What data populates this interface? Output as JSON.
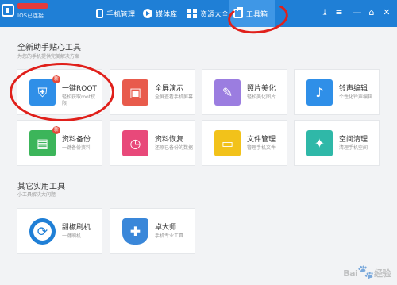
{
  "device": {
    "status": "IOS已连接"
  },
  "nav": {
    "tabs": [
      {
        "label": "手机管理",
        "icon": "phone-icon"
      },
      {
        "label": "媒体库",
        "icon": "media-play-icon"
      },
      {
        "label": "资源大全",
        "icon": "grid-icon"
      },
      {
        "label": "工具箱",
        "icon": "toolbox-icon",
        "active": true
      }
    ]
  },
  "window": {
    "download": "⤓",
    "menu": "≡",
    "minimize": "—",
    "skin": "⌂",
    "close": "✕"
  },
  "newbie": {
    "title": "全新助手贴心工具",
    "subtitle": "为您的手机提供完美解决方案",
    "tools": [
      {
        "name": "一键ROOT",
        "desc": "轻松获取root权限",
        "icon": "shield-key-icon",
        "color": "#2f8fe8",
        "badge": "新"
      },
      {
        "name": "全屏演示",
        "desc": "全屏查看手机屏幕",
        "icon": "screen-cast-icon",
        "color": "#e85b4c"
      },
      {
        "name": "照片美化",
        "desc": "轻松美化图片",
        "icon": "palette-icon",
        "color": "#9b7de0"
      },
      {
        "name": "铃声编辑",
        "desc": "个性化铃声编辑",
        "icon": "music-note-icon",
        "color": "#2f8fe8"
      },
      {
        "name": "资料备份",
        "desc": "一键备份资料",
        "icon": "backup-printer-icon",
        "color": "#3cb55a",
        "badge": "新"
      },
      {
        "name": "资料恢复",
        "desc": "还原已备份的数据",
        "icon": "restore-clock-icon",
        "color": "#e8497a"
      },
      {
        "name": "文件管理",
        "desc": "管理手机文件",
        "icon": "folder-icon",
        "color": "#f2c21a"
      },
      {
        "name": "空间清理",
        "desc": "清理手机空间",
        "icon": "broom-icon",
        "color": "#2fb8a8"
      }
    ]
  },
  "practical": {
    "title": "其它实用工具",
    "subtitle": "小工具解决大问题",
    "tools": [
      {
        "name": "甜椒刷机",
        "desc": "一键刷机",
        "icon": "flash-refresh-icon",
        "color": "#1f7fd6"
      },
      {
        "name": "卓大师",
        "desc": "手机专业工具",
        "icon": "shield-master-icon",
        "color": "#3a87d9"
      }
    ]
  },
  "watermark": {
    "brand": "Bai",
    "suffix": "经验"
  }
}
